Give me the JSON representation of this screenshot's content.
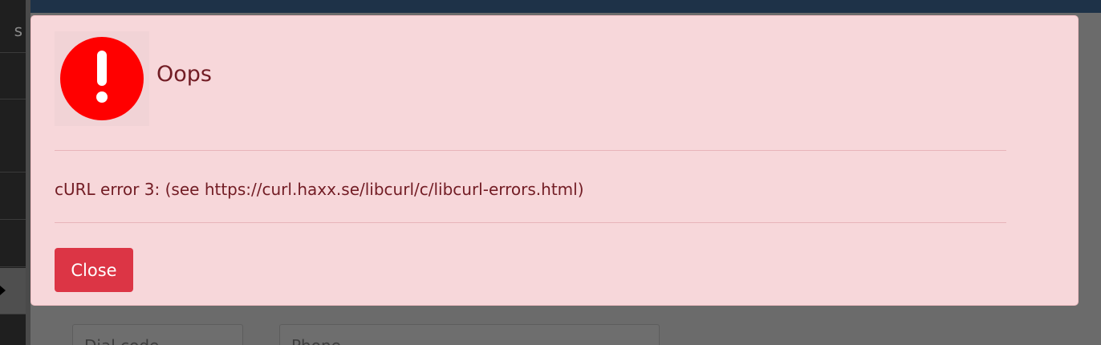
{
  "background": {
    "sidebar_fragment": "s",
    "fields": {
      "dial_code_placeholder": "Dial code",
      "phone_placeholder": "Phone"
    }
  },
  "alert": {
    "icon": "exclamation-circle-icon",
    "title": "Oops",
    "message": "cURL error 3: (see https://curl.haxx.se/libcurl/c/libcurl-errors.html)",
    "close_label": "Close",
    "colors": {
      "background": "#f7d7da",
      "text": "#721c24",
      "icon": "#ff0000",
      "button": "#dc3545"
    }
  }
}
